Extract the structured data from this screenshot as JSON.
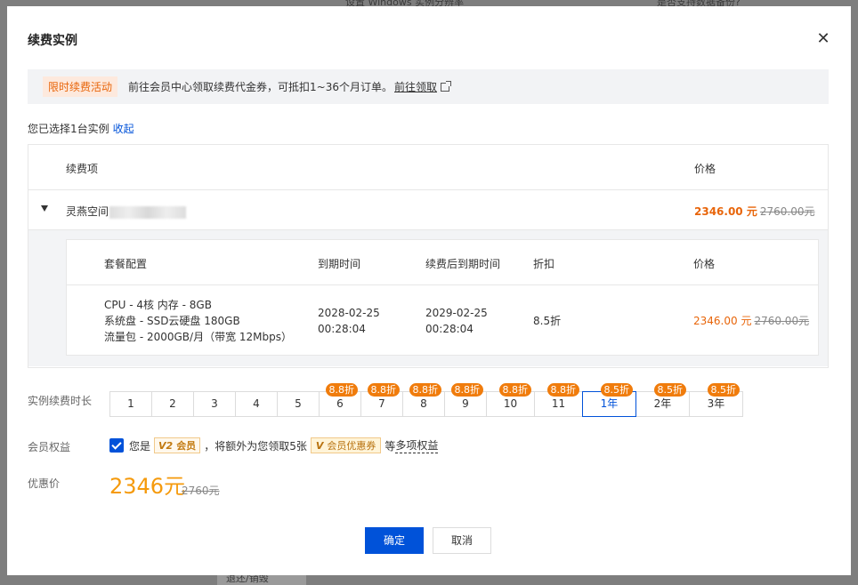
{
  "background": {
    "text1": "设置 Windows 实例分辨率",
    "text2": "是否支持数据备份?",
    "text3": "退还/销毁"
  },
  "modal": {
    "title": "续费实例",
    "close_icon": "close-icon"
  },
  "promo": {
    "tag": "限时续费活动",
    "text": "前往会员中心领取续费代金券，可抵扣1~36个月订单。",
    "link": "前往领取",
    "link_icon": "external-link-icon"
  },
  "selection": {
    "text": "您已选择1台实例",
    "collapse": "收起"
  },
  "outer_table": {
    "headers": [
      "续费项",
      "价格"
    ],
    "row": {
      "name": "灵燕空间",
      "price_now": "2346.00 元",
      "price_old": "2760.00元"
    }
  },
  "inner_table": {
    "headers": [
      "套餐配置",
      "到期时间",
      "续费后到期时间",
      "折扣",
      "价格"
    ],
    "spec": [
      "CPU - 4核 内存 - 8GB",
      "系统盘 - SSD云硬盘 180GB",
      "流量包 - 2000GB/月（带宽 12Mbps）"
    ],
    "expire": [
      "2028-02-25",
      "00:28:04"
    ],
    "expire_after": [
      "2029-02-25",
      "00:28:04"
    ],
    "discount": "8.5折",
    "price_now": "2346.00 元",
    "price_old": "2760.00元"
  },
  "duration": {
    "label": "实例续费时长",
    "options": [
      {
        "label": "1",
        "badge": ""
      },
      {
        "label": "2",
        "badge": ""
      },
      {
        "label": "3",
        "badge": ""
      },
      {
        "label": "4",
        "badge": ""
      },
      {
        "label": "5",
        "badge": ""
      },
      {
        "label": "6",
        "badge": "8.8折"
      },
      {
        "label": "7",
        "badge": "8.8折"
      },
      {
        "label": "8",
        "badge": "8.8折"
      },
      {
        "label": "9",
        "badge": "8.8折"
      },
      {
        "label": "10",
        "badge": "8.8折"
      },
      {
        "label": "11",
        "badge": "8.8折"
      },
      {
        "label": "1年",
        "badge": "8.5折",
        "active": true
      },
      {
        "label": "2年",
        "badge": "8.5折"
      },
      {
        "label": "3年",
        "badge": "8.5折"
      }
    ]
  },
  "member": {
    "label": "会员权益",
    "checked": true,
    "text1": "您是",
    "level_mark": "V2",
    "level": "会员",
    "text2": "，将额外为您领取5张",
    "coupon_mark": "V",
    "coupon": "会员优惠券",
    "text3": "等",
    "more": "多项权益"
  },
  "discount_price": {
    "label": "优惠价",
    "value": "2346元",
    "old": "2760元"
  },
  "buttons": {
    "ok": "确定",
    "cancel": "取消"
  },
  "colors": {
    "primary": "#0052d9",
    "orange": "#e8650a",
    "badge": "#f07c0c",
    "price": "#f59a0c"
  }
}
